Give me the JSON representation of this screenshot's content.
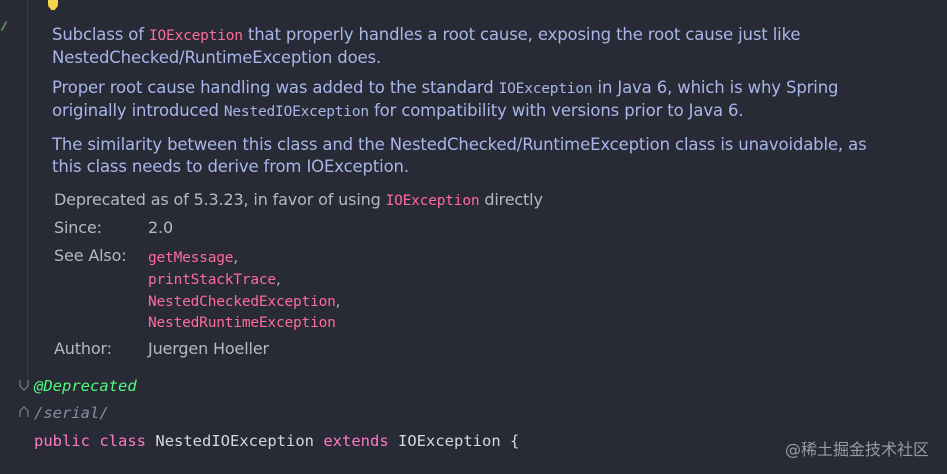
{
  "doc": {
    "p1": {
      "before": "Subclass of ",
      "code": "IOException",
      "after": " that properly handles a root cause, exposing the root cause just like NestedChecked/RuntimeException does."
    },
    "p2": {
      "a": "Proper root cause handling was added to the standard ",
      "code1": "IOException",
      "b": " in Java 6, which is why Spring originally introduced ",
      "code2": "NestedIOException",
      "c": " for compatibility with versions prior to Java 6."
    },
    "p3": "The similarity between this class and the NestedChecked/RuntimeException class is unavoidable, as this class needs to derive from IOException.",
    "deprecated": {
      "label": "Deprecated",
      "text": " as of 5.3.23, in favor of using ",
      "code": "IOException",
      "after": " directly"
    },
    "since_label": "Since:",
    "since_value": "2.0",
    "see_also_label": "See Also:",
    "see_also": [
      "getMessage",
      "printStackTrace",
      "NestedCheckedException",
      "NestedRuntimeException"
    ],
    "author_label": "Author:",
    "author_value": "Juergen Hoeller"
  },
  "code": {
    "annotation": "@Deprecated",
    "comment": "/serial/",
    "decl_public": "public",
    "decl_class": "class",
    "class_name": "NestedIOException",
    "decl_extends": "extends",
    "super_name": "IOException",
    "brace": "{"
  },
  "watermark": "@稀土掘金技术社区",
  "colors": {
    "background": "#282a36",
    "doc_text": "#a8b6e8",
    "code_ref": "#ff6b9a",
    "annotation": "#50fa7b",
    "keyword": "#ff79c6"
  },
  "icons": [
    "lightbulb-icon",
    "edit-marker-icon",
    "fold-icon"
  ]
}
